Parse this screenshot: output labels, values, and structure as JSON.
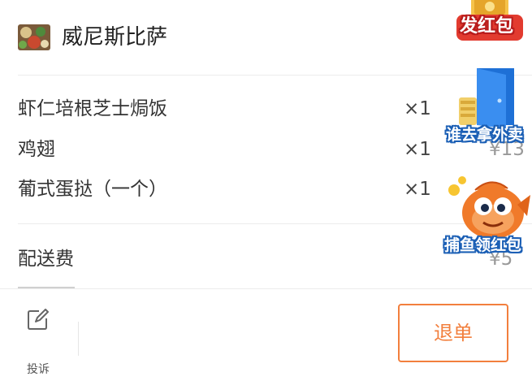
{
  "shop": {
    "name": "威尼斯比萨",
    "thumbnail_icon": "food-thumbnail-icon"
  },
  "order_items": [
    {
      "name": "虾仁培根芝士焗饭",
      "qty": "×1",
      "price": ""
    },
    {
      "name": "鸡翅",
      "qty": "×1",
      "price": "¥13"
    },
    {
      "name": "葡式蛋挞（一个）",
      "qty": "×1",
      "price": ""
    }
  ],
  "fees": {
    "delivery_label": "配送费",
    "delivery_value": "¥5"
  },
  "bottom_bar": {
    "complain_label": "投诉",
    "complain_icon": "edit-icon",
    "refund_label": "退单"
  },
  "promos": {
    "red_packet_label": "发红包",
    "takeout_label": "谁去拿外卖",
    "fishing_label": "捕鱼领红包"
  },
  "colors": {
    "accent": "#f27f3d",
    "promo_red": "#e23b2f",
    "promo_blue": "#1b5fb5"
  }
}
